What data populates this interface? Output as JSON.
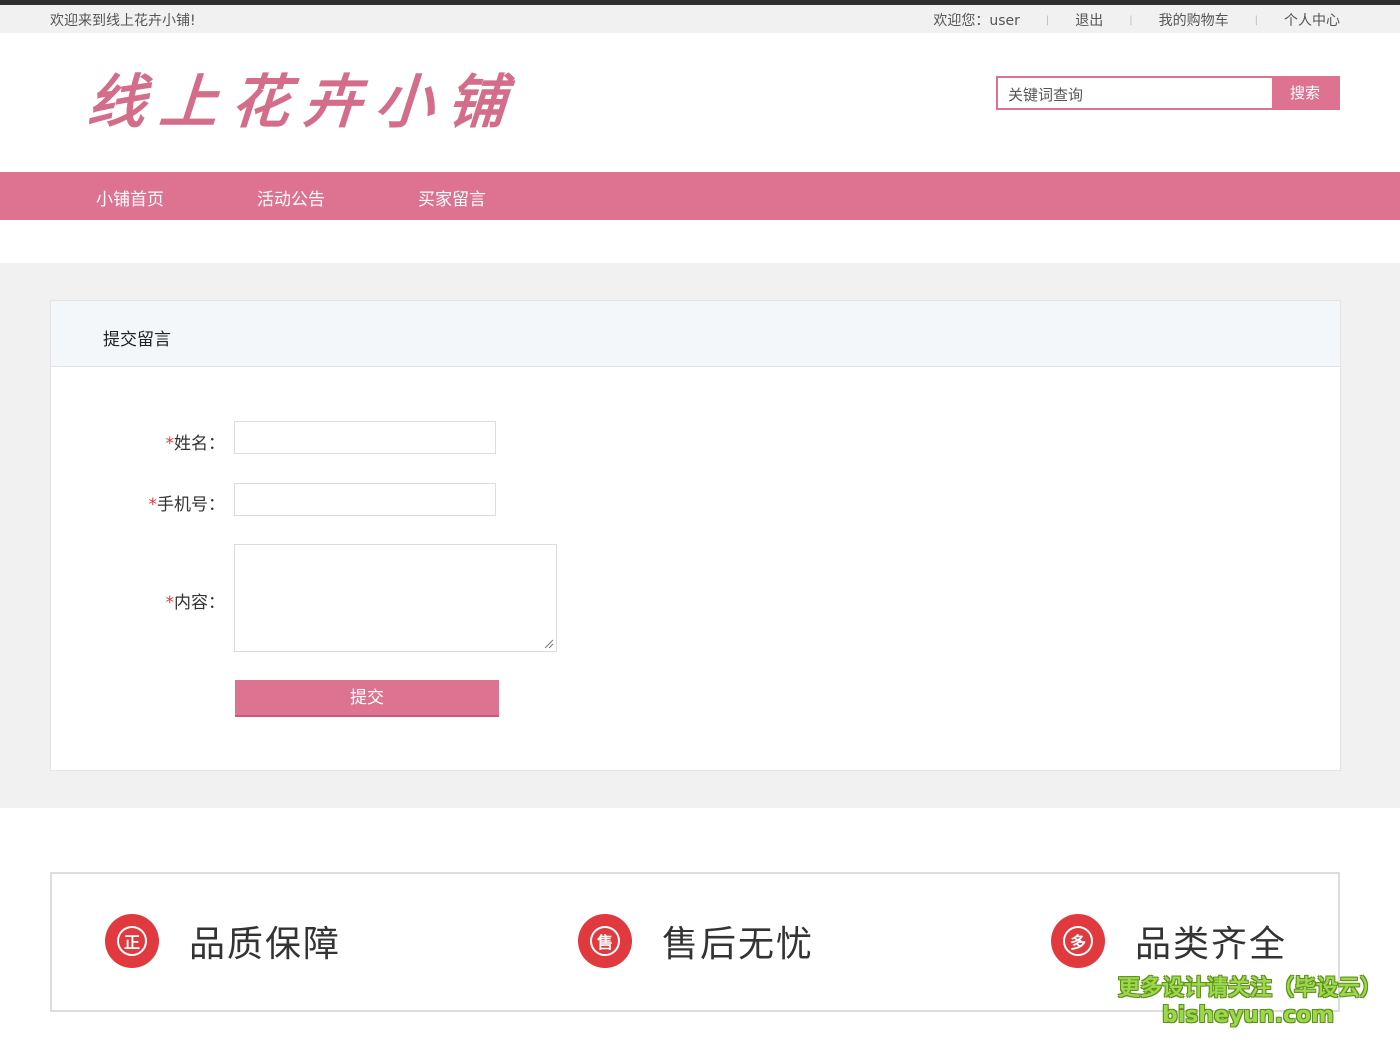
{
  "topbar": {
    "welcome": "欢迎来到线上花卉小铺!",
    "links": [
      {
        "label": "欢迎您：user"
      },
      {
        "label": "退出"
      },
      {
        "label": "我的购物车"
      },
      {
        "label": "个人中心"
      }
    ]
  },
  "header": {
    "logo_text": "线上花卉小铺",
    "search": {
      "placeholder": "关键词查询",
      "button_label": "搜索"
    }
  },
  "nav": {
    "items": [
      {
        "label": "小铺首页"
      },
      {
        "label": "活动公告"
      },
      {
        "label": "买家留言"
      }
    ]
  },
  "panel": {
    "title": "提交留言",
    "fields": {
      "name": {
        "label": "姓名：",
        "required_mark": "*",
        "value": ""
      },
      "phone": {
        "label": "手机号：",
        "required_mark": "*",
        "value": ""
      },
      "content": {
        "label": "内容：",
        "required_mark": "*",
        "value": ""
      }
    },
    "submit_label": "提交"
  },
  "features": [
    {
      "icon_char": "正",
      "icon_name": "certified-badge-icon",
      "label": "品质保障"
    },
    {
      "icon_char": "售",
      "icon_name": "shield-sale-icon",
      "label": "售后无忧"
    },
    {
      "icon_char": "多",
      "icon_name": "multi-category-icon",
      "label": "品类齐全"
    }
  ],
  "watermark": {
    "line1": "更多设计请关注（毕设云）",
    "line2": "bisheyun.com"
  },
  "colors": {
    "accent": "#dd7291",
    "feature_icon": "#e0393e",
    "required_star": "#e0393e"
  }
}
